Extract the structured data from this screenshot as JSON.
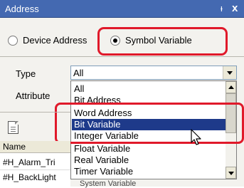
{
  "window": {
    "title": "Address",
    "pin_glyph": "ᵻ",
    "close_glyph": "x"
  },
  "address_mode": {
    "device_label": "Device Address",
    "symbol_label": "Symbol Variable",
    "selected": "symbol"
  },
  "form": {
    "type_label": "Type",
    "type_value": "All",
    "attribute_label": "Attribute"
  },
  "type_options": [
    "All",
    "Bit Address",
    "Word Address",
    "Bit Variable",
    "Integer Variable",
    "Float Variable",
    "Real Variable",
    "Timer Variable"
  ],
  "selected_option": "Bit Variable",
  "grid": {
    "header": "Name",
    "rows": [
      "#H_Alarm_Tri",
      "#H_BackLight"
    ],
    "partial_text": "System Variable"
  },
  "colors": {
    "titlebar": "#4469b1",
    "highlight": "#e0192a",
    "selection": "#1e3a8a"
  }
}
